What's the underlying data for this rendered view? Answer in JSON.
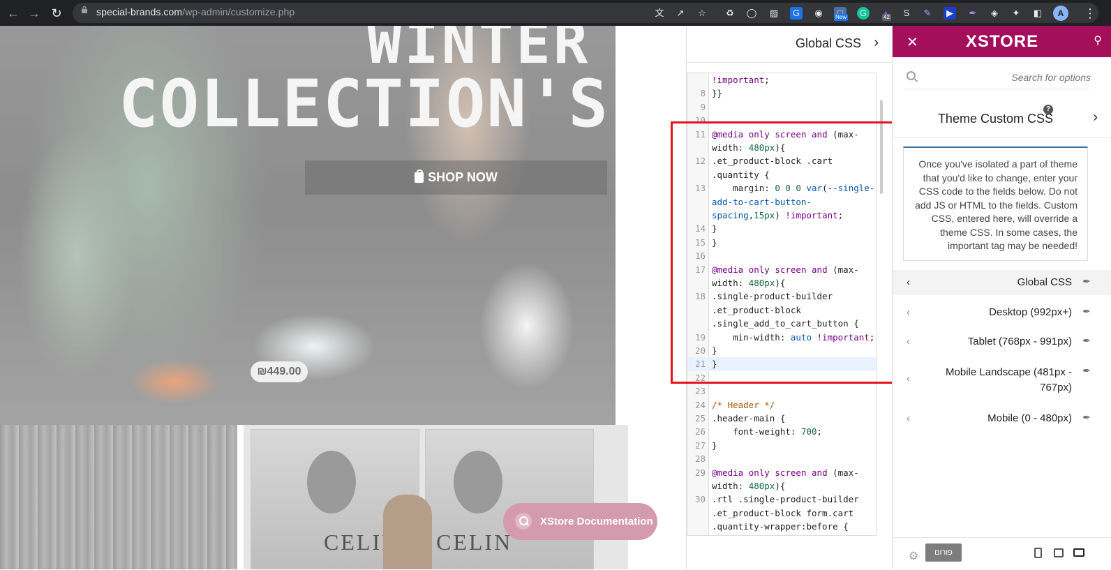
{
  "browser": {
    "url_domain": "special-brands.com",
    "url_path": "/wp-admin/customize.php",
    "ext_new_badge": "New",
    "ext_count_badge": "42",
    "profile_initial": "A"
  },
  "preview": {
    "hero_line1": "WINTER",
    "hero_line2": "COLLECTION'S",
    "shop_button": "SHOP NOW",
    "price": "₪449.00",
    "poster_text_1": "CELIN",
    "poster_text_2": "CELIN",
    "doc_button": "XStore Documentation"
  },
  "editor": {
    "title": "Global CSS",
    "lines": [
      {
        "n": "",
        "t": "!important;"
      },
      {
        "n": "8",
        "t": "}}"
      },
      {
        "n": "9",
        "t": ""
      },
      {
        "n": "10",
        "t": ""
      },
      {
        "n": "11",
        "t": "@media only screen and (max-"
      },
      {
        "n": "",
        "t": "width: 480px){"
      },
      {
        "n": "12",
        "t": ".et_product-block .cart"
      },
      {
        "n": "",
        "t": ".quantity {"
      },
      {
        "n": "13",
        "t": "    margin: 0 0 0 var(--single-"
      },
      {
        "n": "",
        "t": "add-to-cart-button-"
      },
      {
        "n": "",
        "t": "spacing,15px) !important;"
      },
      {
        "n": "14",
        "t": "}"
      },
      {
        "n": "15",
        "t": "}"
      },
      {
        "n": "16",
        "t": ""
      },
      {
        "n": "17",
        "t": "@media only screen and (max-"
      },
      {
        "n": "",
        "t": "width: 480px){"
      },
      {
        "n": "18",
        "t": ".single-product-builder"
      },
      {
        "n": "",
        "t": ".et_product-block"
      },
      {
        "n": "",
        "t": ".single_add_to_cart_button {"
      },
      {
        "n": "19",
        "t": "    min-width: auto !important;"
      },
      {
        "n": "20",
        "t": "}"
      },
      {
        "n": "21",
        "t": "}"
      },
      {
        "n": "22",
        "t": ""
      },
      {
        "n": "23",
        "t": ""
      },
      {
        "n": "24",
        "t": "/* Header */"
      },
      {
        "n": "25",
        "t": ".header-main {"
      },
      {
        "n": "26",
        "t": "    font-weight: 700;"
      },
      {
        "n": "27",
        "t": "}"
      },
      {
        "n": "28",
        "t": ""
      },
      {
        "n": "29",
        "t": "@media only screen and (max-"
      },
      {
        "n": "",
        "t": "width: 480px){"
      },
      {
        "n": "30",
        "t": ".rtl .single-product-builder"
      },
      {
        "n": "",
        "t": ".et_product-block form.cart"
      },
      {
        "n": "",
        "t": ".quantity-wrapper:before {"
      }
    ]
  },
  "sidebar": {
    "brand": "XSTORE",
    "search_placeholder": "Search for options",
    "section_title": "Theme Custom CSS",
    "description": "Once you've isolated a part of theme that you'd like to change, enter your CSS code to the fields below. Do not add JS or HTML to the fields. Custom CSS, entered here, will override a theme CSS. In some cases, the important tag may be needed!",
    "options": [
      {
        "label": "Global CSS"
      },
      {
        "label": "Desktop (992px+)"
      },
      {
        "label": "Tablet (768px - 991px)"
      },
      {
        "label": "Mobile Landscape (481px - 767px)"
      },
      {
        "label": "Mobile (0 - 480px)"
      }
    ],
    "forum_button": "פורום"
  }
}
